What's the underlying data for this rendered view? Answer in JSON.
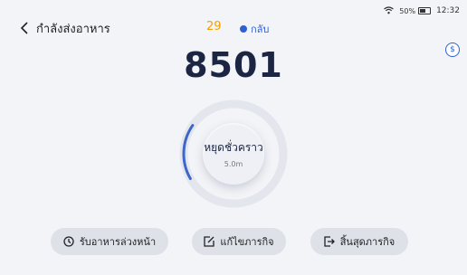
{
  "status": {
    "battery": "50%",
    "time": "12:32",
    "battery_level": 0.5
  },
  "header": {
    "title": "กำลังส่งอาหาร",
    "count": "29",
    "return_label": "กลับ"
  },
  "side_button": {
    "label": "$"
  },
  "counter": {
    "value": "8501"
  },
  "dial": {
    "label": "หยุดชั่วคราว",
    "duration": "5.0m",
    "progress": 0.18
  },
  "actions": {
    "pickup": "รับอาหารล่วงหน้า",
    "edit": "แก้ไขภารกิจ",
    "finish": "สิ้นสุดภารกิจ"
  },
  "colors": {
    "accent": "#2f5fd4",
    "count": "#f5a000",
    "text": "#1c2542"
  }
}
